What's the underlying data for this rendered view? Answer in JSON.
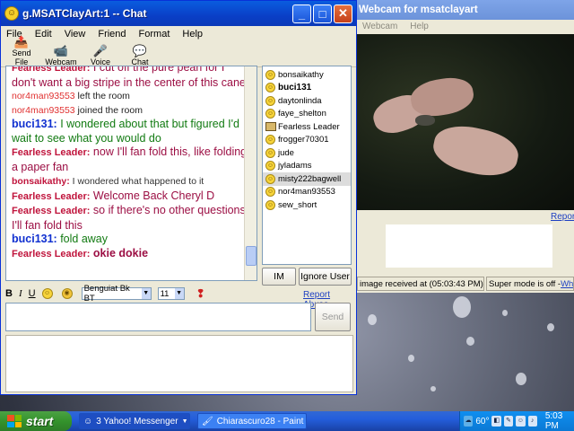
{
  "chat_window": {
    "title": "g.MSATClayArt:1 -- Chat",
    "menu": [
      "File",
      "Edit",
      "View",
      "Friend",
      "Format",
      "Help"
    ],
    "toolbar": [
      "Send File",
      "Webcam",
      "Voice",
      "Chat"
    ],
    "messages": [
      {
        "who": "Fearless Leader:",
        "text": " I cut off the pure pearl for I don't want a big stripe in the center of this cane",
        "style": "fl"
      },
      {
        "who": "nor4man93553",
        "text": " left the room",
        "style": "nor"
      },
      {
        "who": "nor4man93553",
        "text": " joined the room",
        "style": "nor"
      },
      {
        "who": "buci131:",
        "text": " I wondered about that but figured I'd wait to see what you would do",
        "style": "buci"
      },
      {
        "who": "Fearless Leader:",
        "text": " now I'll fan fold this, like folding a paper fan",
        "style": "fl"
      },
      {
        "who": "bonsaikathy:",
        "text": " I wondered what happened to it",
        "style": "bonsai"
      },
      {
        "who": "Fearless Leader:",
        "text": " Welcome Back Cheryl D",
        "style": "fl"
      },
      {
        "who": "Fearless Leader:",
        "text": " so if there's no other questions I'll fan fold this",
        "style": "fl"
      },
      {
        "who": "buci131:",
        "text": " fold away",
        "style": "buci"
      },
      {
        "who": "Fearless Leader:",
        "text": " okie dokie",
        "style": "flbold"
      }
    ],
    "users": [
      {
        "name": "bonsaikathy",
        "bold": false,
        "selected": false,
        "icon": "smiley-icon"
      },
      {
        "name": "buci131",
        "bold": true,
        "selected": false,
        "icon": "smiley-icon"
      },
      {
        "name": "daytonlinda",
        "bold": false,
        "selected": false,
        "icon": "smiley-icon"
      },
      {
        "name": "faye_shelton",
        "bold": false,
        "selected": false,
        "icon": "smiley-icon"
      },
      {
        "name": "Fearless Leader",
        "bold": false,
        "selected": false,
        "icon": "webcam-icon"
      },
      {
        "name": "frogger70301",
        "bold": false,
        "selected": false,
        "icon": "smiley-icon"
      },
      {
        "name": "jude",
        "bold": false,
        "selected": false,
        "icon": "smiley-icon"
      },
      {
        "name": "jyladams",
        "bold": false,
        "selected": false,
        "icon": "smiley-icon"
      },
      {
        "name": "misty222bagwell",
        "bold": false,
        "selected": true,
        "icon": "smiley-icon"
      },
      {
        "name": "nor4man93553",
        "bold": false,
        "selected": false,
        "icon": "smiley-icon"
      },
      {
        "name": "sew_short",
        "bold": false,
        "selected": false,
        "icon": "smiley-icon"
      }
    ],
    "im_label": "IM",
    "ignore_label": "Ignore User",
    "format": {
      "bold": "B",
      "italic": "I",
      "underline": "U",
      "font": "Benguiat Bk BT",
      "size": "11"
    },
    "report_abuse": "Report Abuse",
    "send_label": "Send"
  },
  "webcam_window": {
    "title": "Webcam for msatclayart",
    "menu": [
      "Webcam",
      "Help"
    ],
    "report": "Report",
    "status_image": "image received at (05:03:43 PM)",
    "status_super_prefix": "Super mode is off - ",
    "status_super_link": "What"
  },
  "taskbar": {
    "start": "start",
    "tasks": [
      "3 Yahoo! Messenger",
      "Chiarascuro28 - Paint"
    ],
    "temp": "60°",
    "clock": "5:03 PM"
  }
}
